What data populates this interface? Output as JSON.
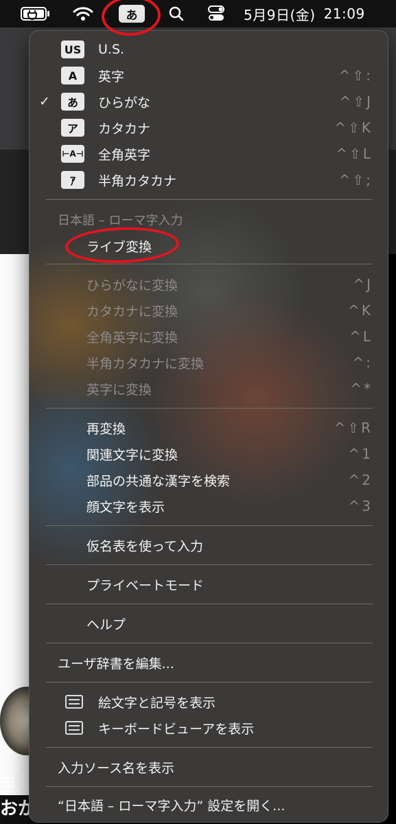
{
  "menubar": {
    "input_mode_icon": "あ",
    "clock_date": "5月9日(金)",
    "clock_time": "21:09",
    "icons": [
      "battery-charging-icon",
      "wifi-icon",
      "spotlight-search-icon",
      "control-center-icon"
    ]
  },
  "background": {
    "text_line1": "ョし",
    "text_line2": "おか"
  },
  "menu": {
    "sources": [
      {
        "icon": "US",
        "label": "U.S.",
        "shortcut": "",
        "checked": false
      },
      {
        "icon": "A",
        "label": "英字",
        "shortcut": "^⇧:",
        "checked": false
      },
      {
        "icon": "あ",
        "label": "ひらがな",
        "shortcut": "^⇧J",
        "checked": true,
        "check_mark": "✓"
      },
      {
        "icon": "ア",
        "label": "カタカナ",
        "shortcut": "^⇧K",
        "checked": false
      },
      {
        "icon": "⊢A⊣",
        "label": "全角英字",
        "shortcut": "^⇧L",
        "checked": false
      },
      {
        "icon": "ｱ",
        "label": "半角カタカナ",
        "shortcut": "^⇧;",
        "checked": false
      }
    ],
    "section_header": "日本語 – ローマ字入力",
    "live_conversion": "ライブ変換",
    "convert_items": [
      {
        "label": "ひらがなに変換",
        "shortcut": "^J"
      },
      {
        "label": "カタカナに変換",
        "shortcut": "^K"
      },
      {
        "label": "全角英字に変換",
        "shortcut": "^L"
      },
      {
        "label": "半角カタカナに変換",
        "shortcut": "^:"
      },
      {
        "label": "英字に変換",
        "shortcut": "^*"
      }
    ],
    "reconvert_items": [
      {
        "label": "再変換",
        "shortcut": "^⇧R"
      },
      {
        "label": "関連文字に変換",
        "shortcut": "^1"
      },
      {
        "label": "部品の共通な漢字を検索",
        "shortcut": "^2"
      },
      {
        "label": "顔文字を表示",
        "shortcut": "^3"
      }
    ],
    "kana_table": "仮名表を使って入力",
    "private_mode": "プライベートモード",
    "help": "ヘルプ",
    "edit_dictionary": "ユーザ辞書を編集...",
    "show_emoji": "絵文字と記号を表示",
    "show_keyboard": "キーボードビューアを表示",
    "show_source_name": "入力ソース名を表示",
    "open_settings": "“日本語 – ローマ字入力” 設定を開く..."
  },
  "colors": {
    "menubar_bg": "#121212",
    "menu_bg": "#3b3a39",
    "disabled_text": "#8c8a88",
    "annotation": "#e4141c"
  }
}
